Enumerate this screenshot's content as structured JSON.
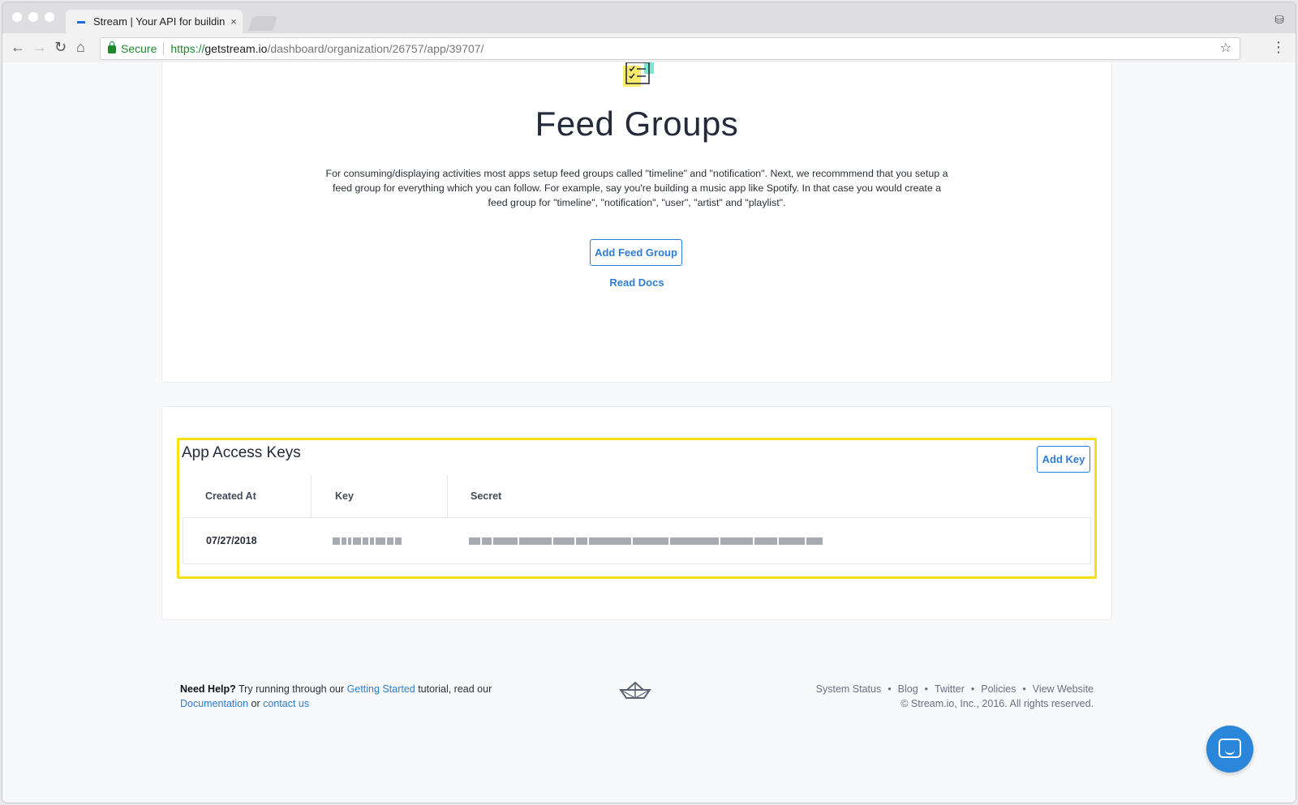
{
  "browser": {
    "tab_title": "Stream | Your API for building",
    "tab_close": "×",
    "secure_label": "Secure",
    "url_scheme": "https://",
    "url_host": "getstream.io",
    "url_path": "/dashboard/organization/26757/app/39707/"
  },
  "feed_groups": {
    "title": "Feed Groups",
    "description": "For consuming/displaying activities most apps setup feed groups called \"timeline\" and \"notification\". Next, we recommmend that you setup a feed group for everything which you can follow. For example, say you're building a music app like Spotify. In that case you would create a feed group for \"timeline\", \"notification\", \"user\", \"artist\" and \"playlist\".",
    "add_button": "Add Feed Group",
    "read_docs": "Read Docs"
  },
  "access_keys": {
    "title": "App Access Keys",
    "add_button": "Add Key",
    "columns": [
      "Created At",
      "Key",
      "Secret"
    ],
    "rows": [
      {
        "created_at": "07/27/2018"
      }
    ]
  },
  "footer": {
    "need_help": "Need Help?",
    "text1": " Try running through our ",
    "getting_started": "Getting Started",
    "text2": " tutorial, read our",
    "documentation": "Documentation",
    "text3": " or ",
    "contact": "contact us",
    "links": [
      "System Status",
      "Blog",
      "Twitter",
      "Policies",
      "View Website"
    ],
    "copyright": "© Stream.io, Inc., 2016. All rights reserved."
  },
  "colors": {
    "accent": "#2d7dd2",
    "highlight": "#f5e012",
    "secure_green": "#1a8a2c"
  }
}
